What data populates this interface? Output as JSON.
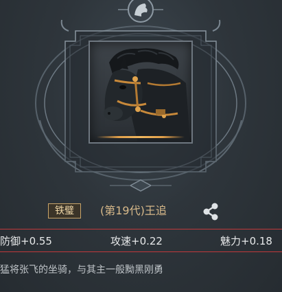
{
  "mount": {
    "rarity": "铁璧",
    "name": "(第19代)王追"
  },
  "stats": {
    "defense": "防御+0.55",
    "speed": "攻速+0.22",
    "charm": "魅力+0.18"
  },
  "description": "猛将张飞的坐骑，与其主一般黝黑刚勇",
  "icons": {
    "share": "share-icon",
    "top_emblem": "horse-emblem-icon"
  },
  "colors": {
    "rarity_border": "#caa66a",
    "name": "#d8b98a",
    "divider": "#c2393b",
    "gold_accent": "#e2a04a"
  }
}
